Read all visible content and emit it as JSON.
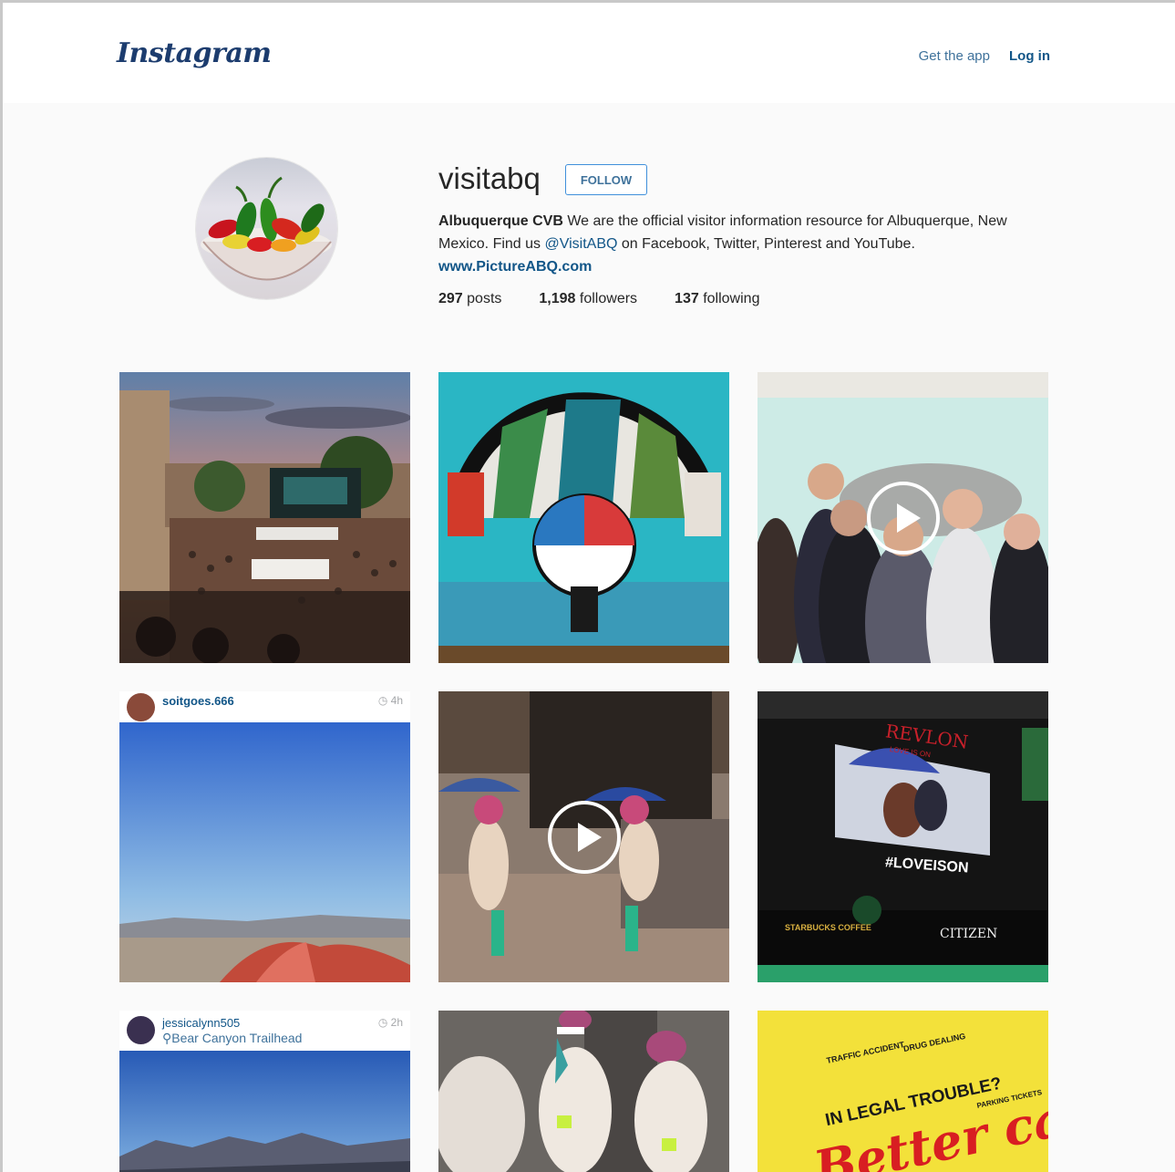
{
  "header": {
    "logo": "Instagram",
    "get_app": "Get the app",
    "login": "Log in"
  },
  "profile": {
    "username": "visitabq",
    "follow_label": "FOLLOW",
    "full_name": "Albuquerque CVB",
    "bio_part1": " We are the official visitor information resource for Albuquerque, New Mexico. Find us ",
    "bio_handle": "@VisitABQ",
    "bio_part2": " on Facebook, Twitter, Pinterest and YouTube.",
    "website": "www.PictureABQ.com",
    "posts_count": "297",
    "posts_label": "posts",
    "followers_count": "1,198",
    "followers_label": "followers",
    "following_count": "137",
    "following_label": "following"
  },
  "posts": [
    {
      "type": "photo"
    },
    {
      "type": "photo"
    },
    {
      "type": "video"
    },
    {
      "type": "repost",
      "user": "soitgoes.666",
      "time": "4h"
    },
    {
      "type": "video"
    },
    {
      "type": "photo",
      "texts": [
        "REVLON",
        "LOVE IS ON",
        "#LOVEISON",
        "CITIZEN",
        "STARBUCKS COFFEE"
      ]
    },
    {
      "type": "repost",
      "user": "jessicalynn505",
      "location": "Bear Canyon Trailhead",
      "time": "2h"
    },
    {
      "type": "photo"
    },
    {
      "type": "photo",
      "texts": [
        "TRAFFIC ACCIDENT",
        "DRUG DEALING",
        "IN LEGAL TROUBLE?",
        "PARKING TICKETS",
        "Better call"
      ]
    }
  ],
  "icons": {
    "clock": "clock-icon",
    "location": "location-pin-icon",
    "play": "play-icon"
  },
  "colors": {
    "link": "#125688",
    "follow_border": "#4090db",
    "page_bg": "#fafafa"
  }
}
